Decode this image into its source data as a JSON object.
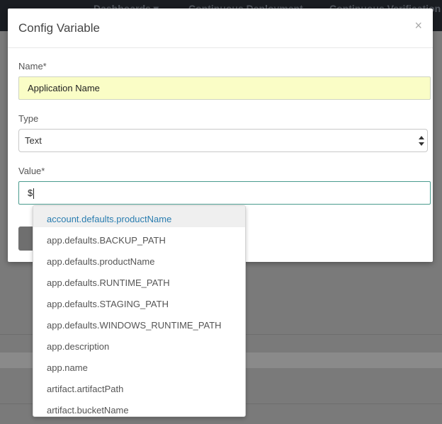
{
  "backdrop": {
    "nav": [
      "Dashboards ▾",
      "Continuous Deployment",
      "Continuous Verification"
    ]
  },
  "modal": {
    "title": "Config Variable",
    "close_glyph": "×",
    "name_label": "Name*",
    "name_value": "Application Name",
    "type_label": "Type",
    "type_value": "Text",
    "value_label": "Value*",
    "value_text": "$"
  },
  "autocomplete": {
    "items": [
      "account.defaults.productName",
      "app.defaults.BACKUP_PATH",
      "app.defaults.productName",
      "app.defaults.RUNTIME_PATH",
      "app.defaults.STAGING_PATH",
      "app.defaults.WINDOWS_RUNTIME_PATH",
      "app.description",
      "app.name",
      "artifact.artifactPath",
      "artifact.bucketName"
    ],
    "active_index": 0
  },
  "colors": {
    "accent": "#2a7db0",
    "focus_border": "#4a9b8e",
    "name_bg": "#fafdc6"
  }
}
